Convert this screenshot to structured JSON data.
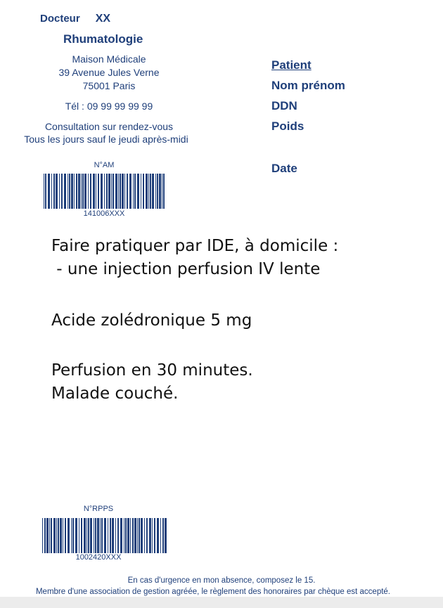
{
  "doctor": {
    "title": "Docteur",
    "name": "XX",
    "specialty": "Rhumatologie"
  },
  "address": {
    "line1": "Maison Médicale",
    "line2": "39 Avenue Jules Verne",
    "line3": "75001 Paris",
    "phone": "Tél : 09 99 99 99 99",
    "consult1": "Consultation sur rendez-vous",
    "consult2": "Tous les jours sauf le jeudi après-midi"
  },
  "am": {
    "label": "N°AM",
    "number": "141006XXX"
  },
  "patient": {
    "title": "Patient",
    "name": "Nom prénom",
    "ddn": "DDN",
    "poids": "Poids",
    "date": "Date"
  },
  "prescription": {
    "line1": "Faire pratiquer par IDE, à domicile :",
    "line2": " - une injection perfusion IV lente",
    "line3": "Acide zolédronique 5 mg",
    "line4": "Perfusion en 30 minutes.",
    "line5": "Malade couché."
  },
  "rpps": {
    "label": "N°RPPS",
    "number": "1002420XXX"
  },
  "footer": {
    "line1": "En cas d'urgence en mon absence, composez le 15.",
    "line2": "Membre d'une association de gestion agréée, le règlement des honoraires par chèque est accepté."
  }
}
